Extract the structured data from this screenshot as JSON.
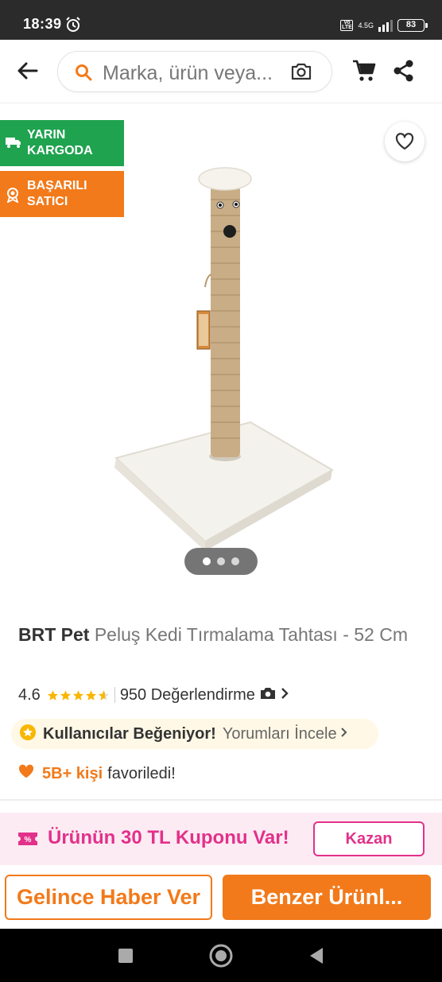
{
  "status_bar": {
    "time": "18:39",
    "network": "4.5G",
    "volte": "Vo LTE",
    "battery": "83"
  },
  "header": {
    "search_placeholder": "Marka, ürün veya..."
  },
  "badges": {
    "delivery": "YARIN KARGODA",
    "seller": "BAŞARILI SATICI"
  },
  "product": {
    "brand": "BRT Pet",
    "name": "Peluş Kedi Tırmalama Tahtası - 52 Cm",
    "rating": "4.6",
    "rating_value": 4.6,
    "review_count": "950 Değerlendirme",
    "users_like": "Kullanıcılar Beğeniyor!",
    "see_reviews": "Yorumları İncele",
    "favorites_count": "5B+ kişi",
    "favorites_suffix": "favoriledi!"
  },
  "gallery": {
    "total": 3,
    "current": 1
  },
  "coupon": {
    "text": "Ürünün 30 TL Kuponu Var!",
    "button": "Kazan"
  },
  "actions": {
    "notify": "Gelince Haber Ver",
    "similar": "Benzer Ürünl..."
  },
  "colors": {
    "orange": "#f27a1a",
    "green": "#1fa34f",
    "pink": "#e2318a"
  }
}
